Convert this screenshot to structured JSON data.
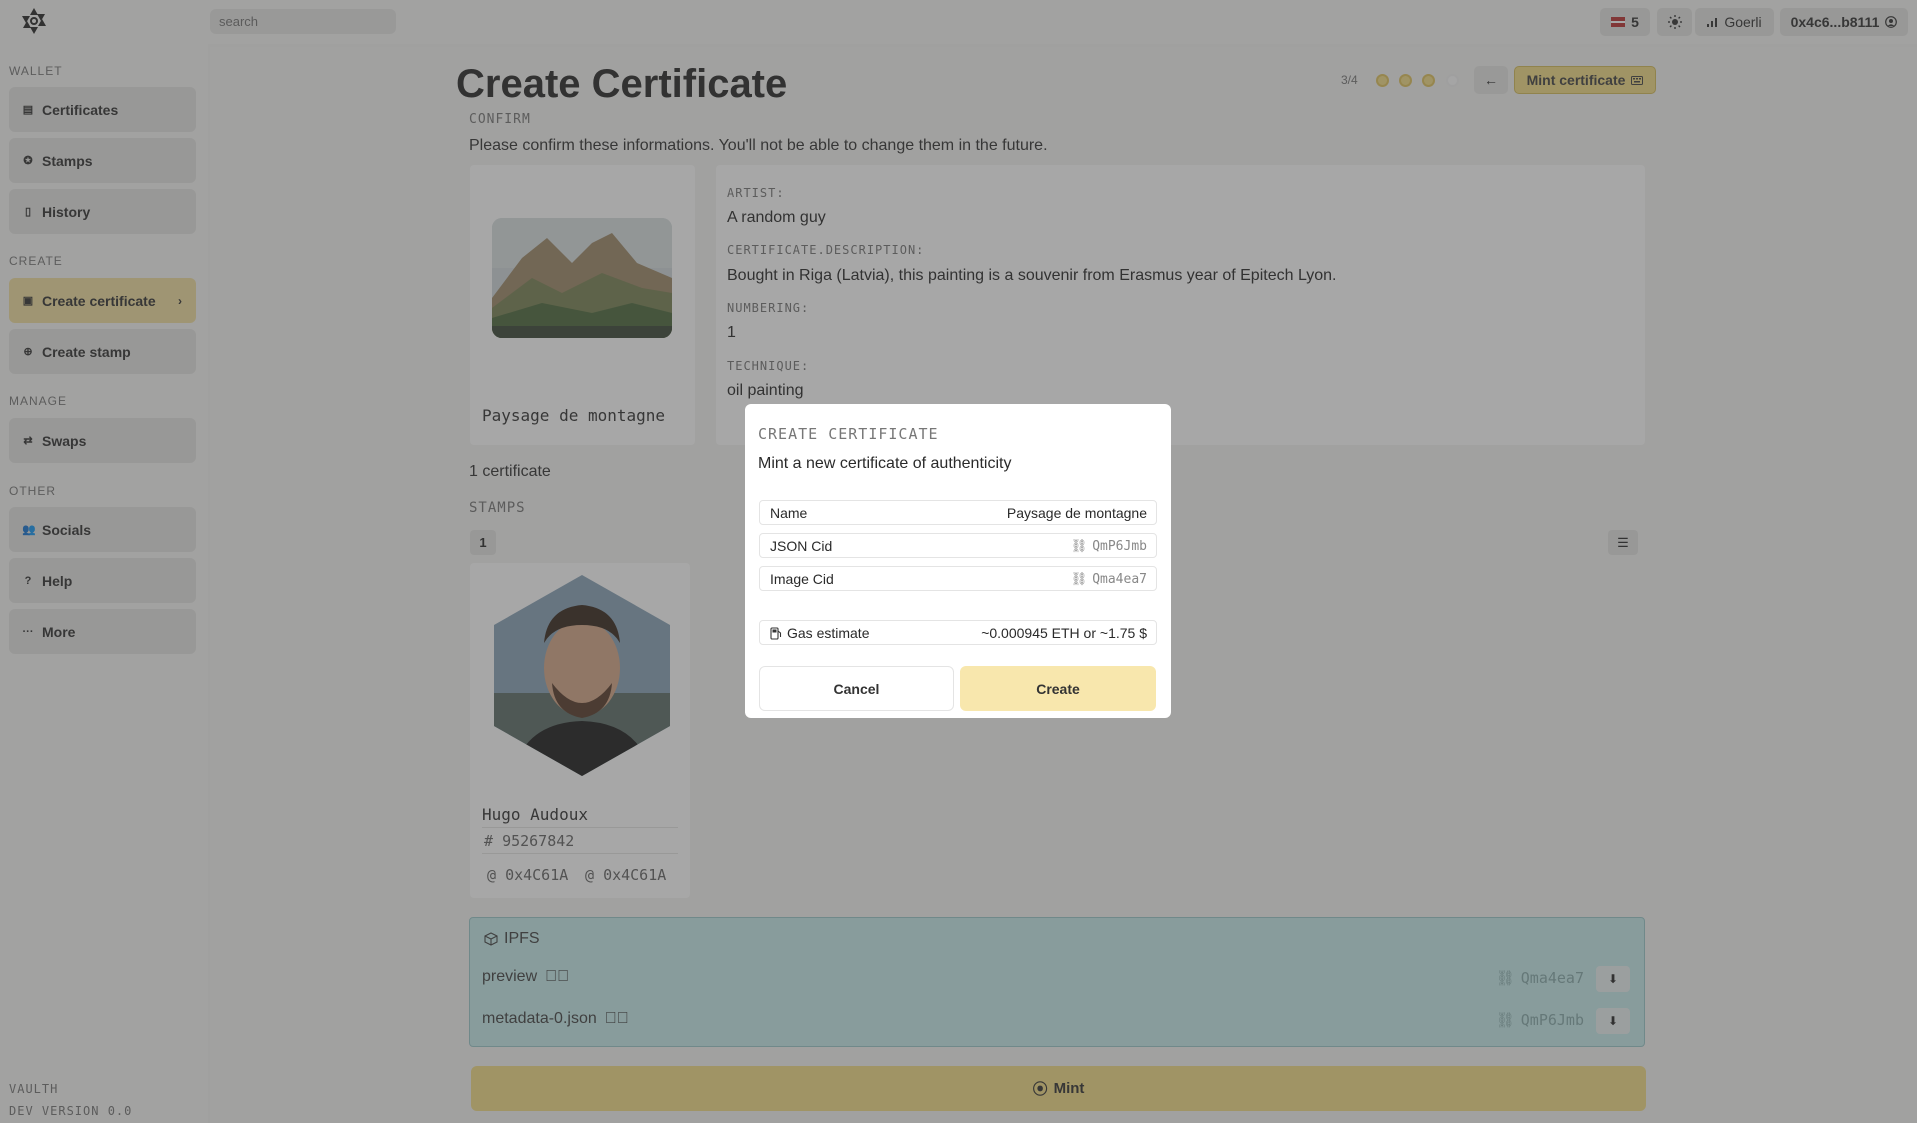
{
  "topbar": {
    "search_placeholder": "search",
    "flag_count": "5",
    "theme_icon": "sun-icon",
    "network": "Goerli",
    "account": "0x4c6...b8111"
  },
  "sidebar": {
    "sections": {
      "wallet": "WALLET",
      "create": "CREATE",
      "manage": "MANAGE",
      "other": "OTHER"
    },
    "items": [
      {
        "label": "Certificates",
        "icon": "certificates-icon"
      },
      {
        "label": "Stamps",
        "icon": "stamps-icon"
      },
      {
        "label": "History",
        "icon": "history-icon"
      },
      {
        "label": "Create certificate",
        "icon": "plus-square-icon",
        "active": true
      },
      {
        "label": "Create stamp",
        "icon": "plus-circle-icon"
      },
      {
        "label": "Swaps",
        "icon": "swap-icon"
      },
      {
        "label": "Socials",
        "icon": "users-icon"
      },
      {
        "label": "Help",
        "icon": "help-icon"
      },
      {
        "label": "More",
        "icon": "more-icon"
      }
    ],
    "footer": {
      "app": "VAULTH",
      "version": "DEV VERSION 0.0"
    }
  },
  "main": {
    "title": "Create Certificate",
    "step": "3/4",
    "mint_certificate_label": "Mint certificate",
    "confirm_label": "CONFIRM",
    "confirm_text": "Please confirm these informations. You'll not be able to change them in the future.",
    "artwork_name": "Paysage de montagne",
    "fields": [
      {
        "label": "ARTIST:",
        "value": "A random guy"
      },
      {
        "label": "CERTIFICATE.DESCRIPTION:",
        "value": "Bought in Riga (Latvia), this painting is a souvenir from Erasmus year of Epitech Lyon."
      },
      {
        "label": "NUMBERING:",
        "value": "1"
      },
      {
        "label": "TECHNIQUE:",
        "value": "oil painting"
      }
    ],
    "certificate_count": "1 certificate",
    "stamps_label": "STAMPS",
    "stamps_count": "1",
    "stamp": {
      "name": "Hugo Audoux",
      "id": "95267842",
      "addr1": "0x4C61A",
      "addr2": "0x4C61A"
    },
    "ipfs": {
      "title": "IPFS",
      "rows": [
        {
          "name": "preview",
          "cid": "Qma4ea7"
        },
        {
          "name": "metadata-0.json",
          "cid": "QmP6Jmb"
        }
      ]
    },
    "mint_label": "Mint"
  },
  "modal": {
    "title": "CREATE CERTIFICATE",
    "subtitle": "Mint a new certificate of authenticity",
    "rows": [
      {
        "key": "Name",
        "value": "Paysage de montagne"
      },
      {
        "key": "JSON Cid",
        "value": "QmP6Jmb"
      },
      {
        "key": "Image Cid",
        "value": "Qma4ea7"
      }
    ],
    "gas_label": "Gas estimate",
    "gas_value": "~0.000945 ETH or ~1.75 $",
    "cancel_label": "Cancel",
    "create_label": "Create"
  }
}
